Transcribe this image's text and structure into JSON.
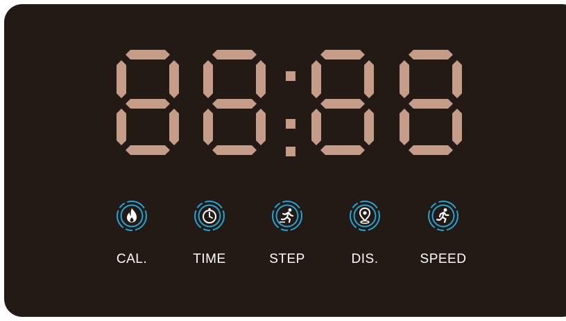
{
  "display": {
    "digits": [
      "8",
      "8",
      "8",
      "8"
    ],
    "separator": ":",
    "segment_color": "#c49c87",
    "background_color": "#231a16",
    "accent_color": "#23a6d6"
  },
  "modes": [
    {
      "label": "CAL.",
      "icon": "flame-icon"
    },
    {
      "label": "TIME",
      "icon": "stopwatch-icon"
    },
    {
      "label": "STEP",
      "icon": "runner-step-icon"
    },
    {
      "label": "DIS.",
      "icon": "location-pin-icon"
    },
    {
      "label": "SPEED",
      "icon": "runner-speed-icon"
    }
  ]
}
